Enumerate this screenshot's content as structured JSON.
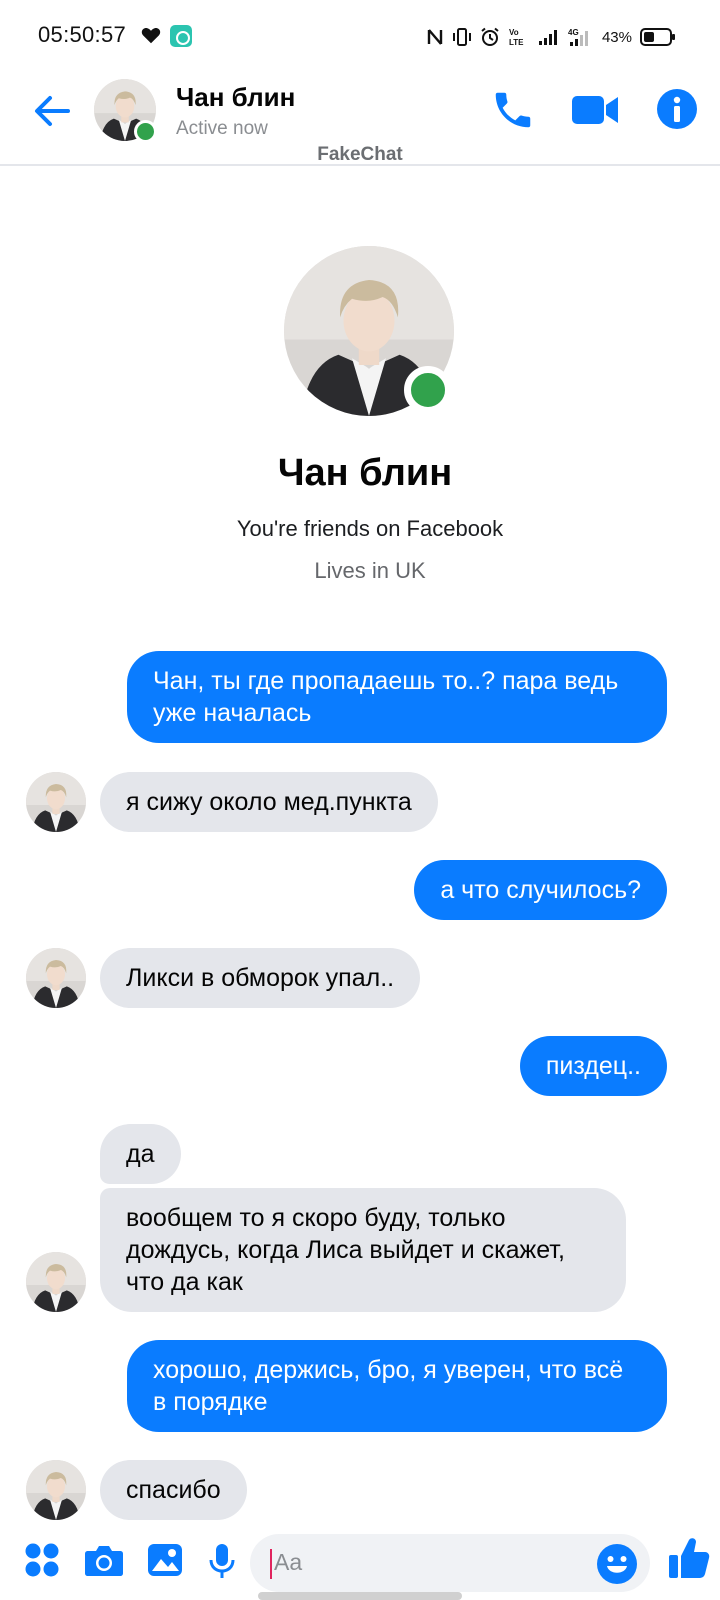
{
  "status_bar": {
    "time": "05:50:57",
    "battery_percent": "43%",
    "battery_level": 0.43,
    "icons": [
      "heart-icon",
      "app-notification-icon",
      "nfc-icon",
      "vibrate-icon",
      "alarm-icon",
      "volte-icon",
      "signal-icon",
      "4g-signal-icon",
      "battery-icon"
    ]
  },
  "header": {
    "contact_name": "Чан блин",
    "status": "Active now",
    "watermark": "FakeChat",
    "icons": [
      "back-arrow-icon",
      "phone-icon",
      "video-camera-icon",
      "info-icon"
    ],
    "accent_color": "#0a7cff",
    "online_color": "#31a24c"
  },
  "profile": {
    "name": "Чан блин",
    "friends_text": "You're friends on Facebook",
    "lives_text": "Lives in UK"
  },
  "messages": [
    {
      "direction": "out",
      "text": "Чан, ты где пропадаешь то..? пара ведь уже началась"
    },
    {
      "direction": "in",
      "text": "я сижу около мед.пункта"
    },
    {
      "direction": "out",
      "text": "а что случилось?"
    },
    {
      "direction": "in",
      "text": "Ликси в обморок упал.."
    },
    {
      "direction": "out",
      "text": "пиздец.."
    },
    {
      "direction": "in",
      "text": "да"
    },
    {
      "direction": "in",
      "text": "вообщем то я скоро буду, только дождусь, когда Лиса выйдет и скажет, что да как"
    },
    {
      "direction": "out",
      "text": "хорошо, держись, бро, я уверен, что всё в порядке"
    },
    {
      "direction": "in",
      "text": "спасибо"
    }
  ],
  "composer": {
    "placeholder": "Aa",
    "icons": [
      "apps-grid-icon",
      "camera-icon",
      "gallery-icon",
      "microphone-icon",
      "emoji-icon",
      "thumbs-up-icon"
    ]
  },
  "colors": {
    "outgoing_bubble": "#0a7cff",
    "incoming_bubble": "#e4e6eb"
  }
}
